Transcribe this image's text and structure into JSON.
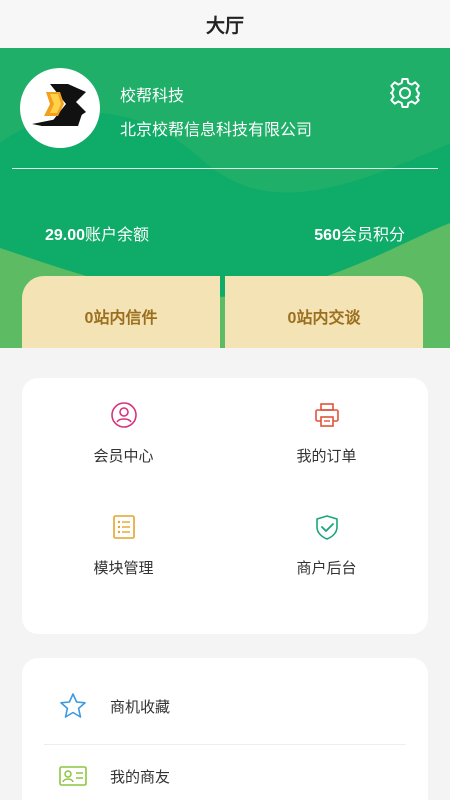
{
  "header": {
    "title": "大厅"
  },
  "profile": {
    "company_short": "校帮科技",
    "company_full": "北京校帮信息科技有限公司"
  },
  "stats": {
    "balance_value": "29.00",
    "balance_label": "账户余额",
    "points_value": "560",
    "points_label": "会员积分"
  },
  "messages": {
    "inbox_label": "0站内信件",
    "chat_label": "0站内交谈"
  },
  "grid": {
    "member_center": "会员中心",
    "my_orders": "我的订单",
    "module_management": "模块管理",
    "merchant_backend": "商户后台"
  },
  "list": {
    "favorites": "商机收藏",
    "my_friends": "我的商友"
  },
  "colors": {
    "brand_green": "#0eac68",
    "light_green": "#5dbb63",
    "button_bg": "#f3e3b5",
    "button_text": "#9c6f1f",
    "icon_pink": "#d6337f",
    "icon_red": "#e0533a",
    "icon_orange": "#e4a42a",
    "icon_teal": "#1aa67a",
    "icon_blue": "#3b9ae1",
    "icon_lime": "#8cc63f"
  }
}
